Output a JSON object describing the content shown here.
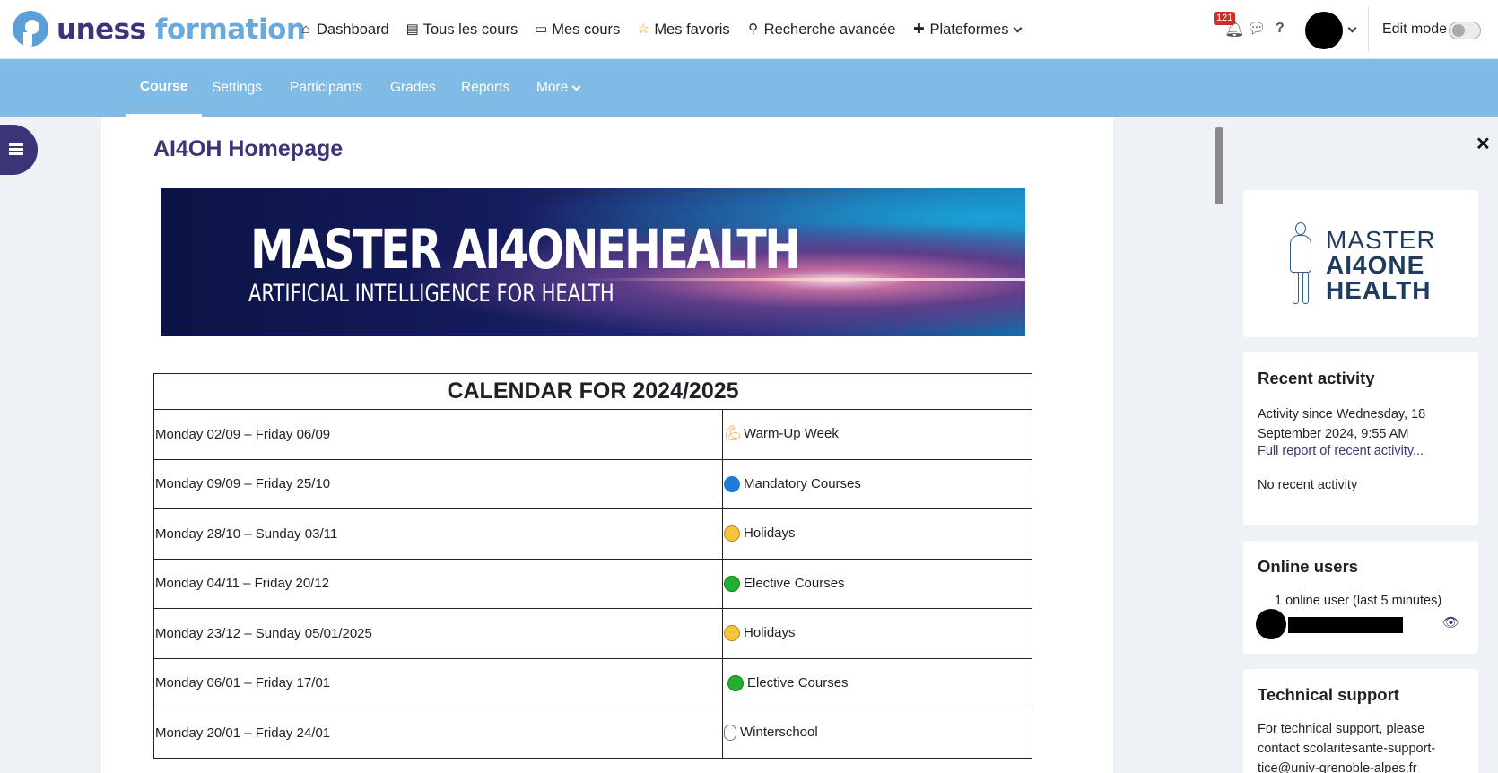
{
  "brand": {
    "part1": "uness",
    "part2": "formation"
  },
  "mainnav": [
    {
      "label": "Dashboard",
      "icon": "home-icon",
      "glyph": "⌂"
    },
    {
      "label": "Tous les cours",
      "icon": "books-icon",
      "glyph": "▤"
    },
    {
      "label": "Mes cours",
      "icon": "book-icon",
      "glyph": "▭"
    },
    {
      "label": "Mes favoris",
      "icon": "star-icon",
      "glyph": "☆"
    },
    {
      "label": "Recherche avancée",
      "icon": "magnifier-icon",
      "glyph": "⚲"
    },
    {
      "label": "Plateformes",
      "icon": "plus-icon",
      "glyph": "✚"
    }
  ],
  "notifications": {
    "count": "121"
  },
  "help_glyph": "?",
  "edit_mode": {
    "label": "Edit mode"
  },
  "subnav": [
    "Course",
    "Settings",
    "Participants",
    "Grades",
    "Reports",
    "More"
  ],
  "page": {
    "title": "AI4OH Homepage"
  },
  "banner": {
    "line1": "MASTER AI4ONEHEALTH",
    "line2": "ARTIFICIAL INTELLIGENCE FOR HEALTH"
  },
  "calendar": {
    "heading": "CALENDAR FOR 2024/2025",
    "rows": [
      {
        "dates": "Monday 02/09 – Friday 06/09",
        "label": "Warm-Up Week",
        "icon": "muscle"
      },
      {
        "dates": "Monday 09/09 – Friday 25/10",
        "label": "Mandatory Courses",
        "icon": "blue-circle"
      },
      {
        "dates": "Monday 28/10 – Sunday 03/11",
        "label": "Holidays",
        "icon": "sleeping-face"
      },
      {
        "dates": "Monday 04/11 – Friday 20/12",
        "label": "Elective Courses",
        "icon": "green-circle"
      },
      {
        "dates": "Monday 23/12 – Sunday 05/01/2025",
        "label": "Holidays",
        "icon": "sleeping-face"
      },
      {
        "dates": "Monday 06/01 – Friday 17/01",
        "label": "Elective Courses",
        "icon": "green-circle"
      },
      {
        "dates": "Monday 20/01 – Friday 24/01",
        "label": "Winterschool",
        "icon": "snowman"
      }
    ]
  },
  "drawer": {
    "logo": {
      "l1": "MASTER",
      "l2": "AI4ONE",
      "l3": "HEALTH"
    },
    "recent": {
      "title": "Recent activity",
      "since": "Activity since Wednesday, 18 September 2024, 9:55 AM",
      "link": "Full report of recent activity...",
      "empty": "No recent activity"
    },
    "online": {
      "title": "Online users",
      "count": "1 online user (last 5 minutes)"
    },
    "tech": {
      "title": "Technical support",
      "text": "For technical support, please contact scolaritesante-support-tice@univ-grenoble-alpes.fr"
    }
  },
  "colors": {
    "brand_dark": "#3b3577",
    "brand_light": "#6aa9dc",
    "subnav_bg": "#7fbbe5"
  }
}
